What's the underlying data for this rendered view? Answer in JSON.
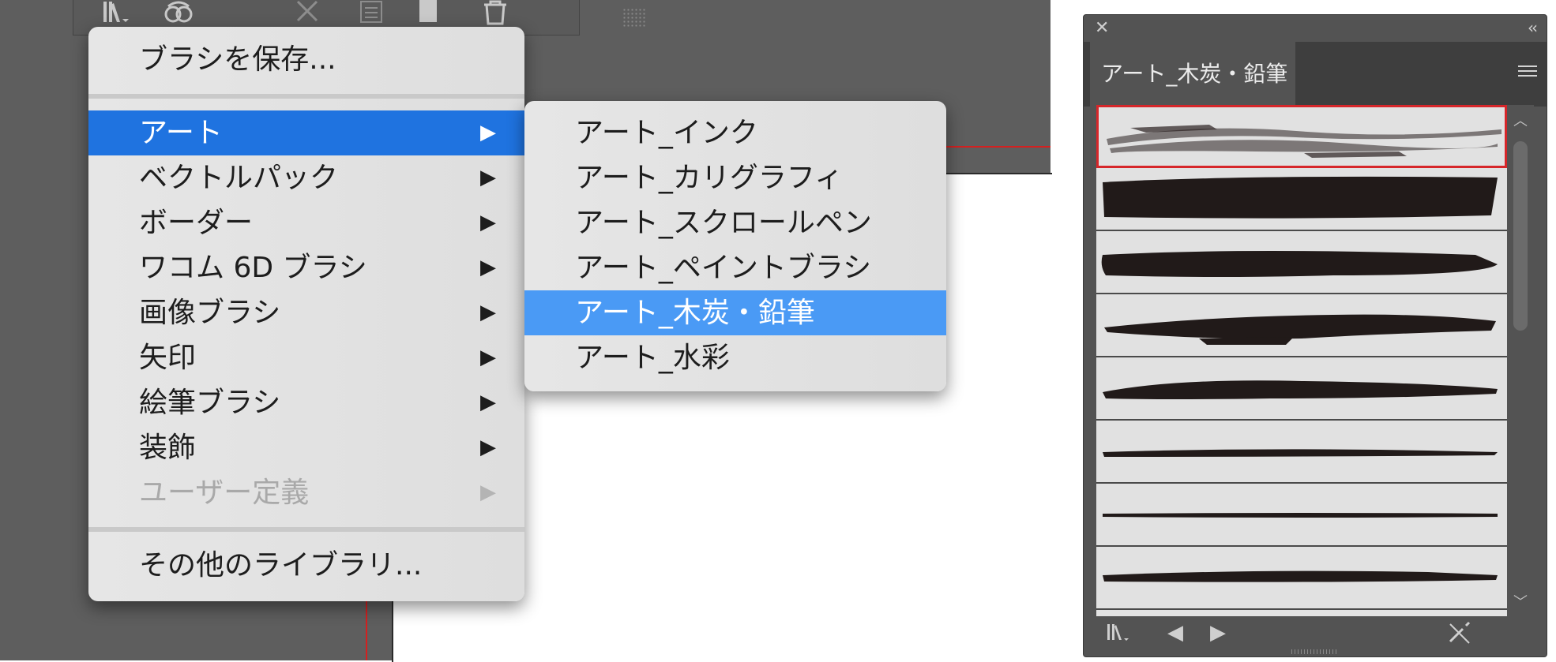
{
  "main_menu": {
    "save": "ブラシを保存...",
    "items": [
      {
        "label": "アート",
        "active": true,
        "disabled": false
      },
      {
        "label": "ベクトルパック",
        "active": false,
        "disabled": false
      },
      {
        "label": "ボーダー",
        "active": false,
        "disabled": false
      },
      {
        "label": "ワコム 6D ブラシ",
        "active": false,
        "disabled": false
      },
      {
        "label": "画像ブラシ",
        "active": false,
        "disabled": false
      },
      {
        "label": "矢印",
        "active": false,
        "disabled": false
      },
      {
        "label": "絵筆ブラシ",
        "active": false,
        "disabled": false
      },
      {
        "label": "装飾",
        "active": false,
        "disabled": false
      },
      {
        "label": "ユーザー定義",
        "active": false,
        "disabled": true
      }
    ],
    "other": "その他のライブラリ...",
    "arrow": "▶"
  },
  "sub_menu": {
    "items": [
      {
        "label": "アート_インク",
        "active": false
      },
      {
        "label": "アート_カリグラフィ",
        "active": false
      },
      {
        "label": "アート_スクロールペン",
        "active": false
      },
      {
        "label": "アート_ペイントブラシ",
        "active": false
      },
      {
        "label": "アート_木炭・鉛筆",
        "active": true
      },
      {
        "label": "アート_水彩",
        "active": false
      }
    ]
  },
  "panel": {
    "close": "✕",
    "collapse": "‹‹",
    "tab": "アート_木炭・鉛筆",
    "brush_count": 8,
    "selected_index": 0,
    "footer": {
      "library": "library-menu-icon",
      "prev": "◀",
      "next": "▶",
      "remove": "remove-stroke-icon"
    }
  },
  "colors": {
    "highlight": "#1f73e0",
    "sub_highlight": "#4a9af5",
    "selection": "#d6262a"
  }
}
